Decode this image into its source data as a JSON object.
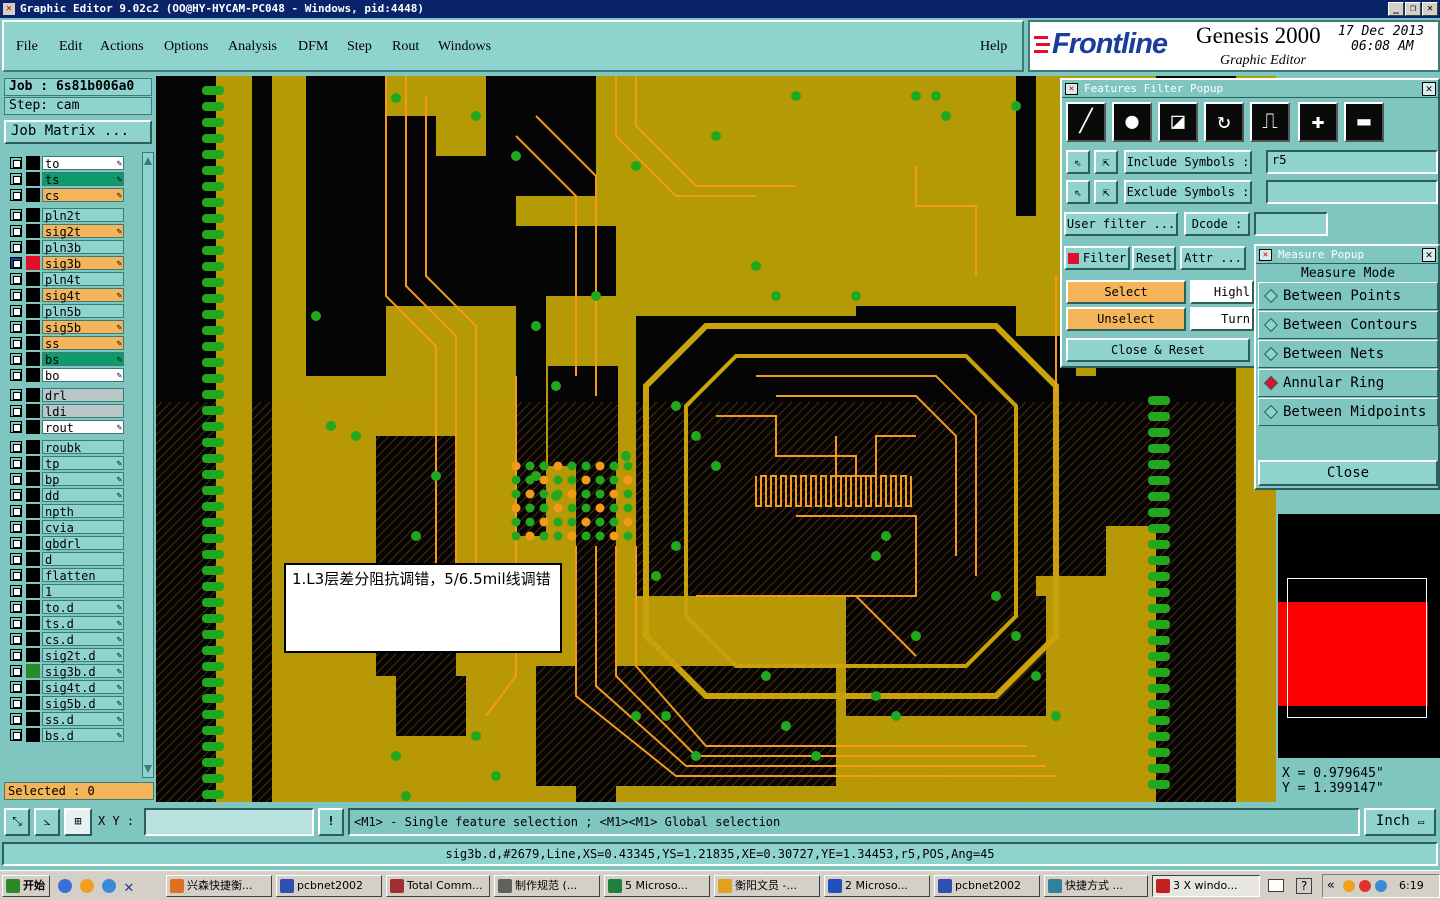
{
  "window": {
    "title": "Graphic Editor 9.02c2 (OO@HY-HYCAM-PC048 - Windows, pid:4448)",
    "controls": [
      "_",
      "❐",
      "✕"
    ]
  },
  "menu": [
    "File",
    "Edit",
    "Actions",
    "Options",
    "Analysis",
    "DFM",
    "Step",
    "Rout",
    "Windows"
  ],
  "menu_help": "Help",
  "brand": {
    "logo": "Frontline",
    "product": "Genesis 2000",
    "subtitle": "Graphic Editor",
    "date": "17 Dec 2013",
    "time": "06:08 AM"
  },
  "job": {
    "job_label": "Job : 6s81b006a0",
    "step_label": "Step: cam",
    "matrix_button": "Job Matrix ..."
  },
  "layers": [
    {
      "name": "to",
      "color": "#ffffff",
      "pen": true
    },
    {
      "name": "ts",
      "color": "#0f9a6a",
      "pen": true
    },
    {
      "name": "cs",
      "color": "#f4b55a",
      "pen": true
    },
    {
      "name": "pln2t",
      "color": "#8fd3cf",
      "pen": false
    },
    {
      "name": "sig2t",
      "color": "#f4b55a",
      "pen": true
    },
    {
      "name": "pln3b",
      "color": "#8fd3cf",
      "pen": false
    },
    {
      "name": "sig3b",
      "color": "#f4b55a",
      "pen": true
    },
    {
      "name": "pln4t",
      "color": "#8fd3cf",
      "pen": false
    },
    {
      "name": "sig4t",
      "color": "#f4b55a",
      "pen": true
    },
    {
      "name": "pln5b",
      "color": "#8fd3cf",
      "pen": false
    },
    {
      "name": "sig5b",
      "color": "#f4b55a",
      "pen": true
    },
    {
      "name": "ss",
      "color": "#f4b55a",
      "pen": true
    },
    {
      "name": "bs",
      "color": "#0f9a6a",
      "pen": true
    },
    {
      "name": "bo",
      "color": "#ffffff",
      "pen": true
    },
    {
      "name": "drl",
      "color": "#b8c8c8",
      "pen": false
    },
    {
      "name": "ldi",
      "color": "#b8c8c8",
      "pen": false
    },
    {
      "name": "rout",
      "color": "#ffffff",
      "pen": true
    },
    {
      "name": "roubk",
      "color": "#8fd3cf",
      "pen": false
    },
    {
      "name": "tp",
      "color": "#8fd3cf",
      "pen": true
    },
    {
      "name": "bp",
      "color": "#8fd3cf",
      "pen": true
    },
    {
      "name": "dd",
      "color": "#8fd3cf",
      "pen": true
    },
    {
      "name": "npth",
      "color": "#8fd3cf",
      "pen": false
    },
    {
      "name": "cvia",
      "color": "#8fd3cf",
      "pen": false
    },
    {
      "name": "gbdrl",
      "color": "#8fd3cf",
      "pen": false
    },
    {
      "name": "d",
      "color": "#8fd3cf",
      "pen": false
    },
    {
      "name": "flatten",
      "color": "#8fd3cf",
      "pen": false
    },
    {
      "name": "1",
      "color": "#8fd3cf",
      "pen": false
    },
    {
      "name": "to.d",
      "color": "#8fd3cf",
      "pen": true
    },
    {
      "name": "ts.d",
      "color": "#8fd3cf",
      "pen": true
    },
    {
      "name": "cs.d",
      "color": "#8fd3cf",
      "pen": true
    },
    {
      "name": "sig2t.d",
      "color": "#8fd3cf",
      "pen": true
    },
    {
      "name": "sig3b.d",
      "color": "#8fd3cf",
      "pen": true
    },
    {
      "name": "sig4t.d",
      "color": "#8fd3cf",
      "pen": true
    },
    {
      "name": "sig5b.d",
      "color": "#8fd3cf",
      "pen": true
    },
    {
      "name": "ss.d",
      "color": "#8fd3cf",
      "pen": true
    },
    {
      "name": "bs.d",
      "color": "#8fd3cf",
      "pen": true
    }
  ],
  "selected_label": "Selected : 0",
  "features_filter": {
    "title": "Features Filter Popup",
    "include_label": "Include Symbols :",
    "include_value": "r5",
    "exclude_label": "Exclude Symbols :",
    "exclude_value": "",
    "user_filter": "User filter ...",
    "dcode_label": "Dcode :",
    "filter_label": "Filter",
    "reset": "Reset",
    "attr": "Attr ...",
    "select": "Select",
    "unselect": "Unselect",
    "highlight": "Highl",
    "turn": "Turn",
    "close_reset": "Close & Reset",
    "tool_icons": [
      "line-icon",
      "pad-icon",
      "surface-icon",
      "arc-icon",
      "text-icon",
      "plus-icon",
      "minus-icon"
    ]
  },
  "measure": {
    "title": "Measure Popup",
    "mode_label": "Measure Mode",
    "options": [
      "Between Points",
      "Between Contours",
      "Between Nets",
      "Annular Ring",
      "Between Midpoints"
    ],
    "selected": "Annular Ring",
    "close": "Close"
  },
  "coords": {
    "x": "X = 0.979645\"",
    "y": "Y = 1.399147\""
  },
  "annotation": "1.L3层差分阻抗调错，5/6.5mil线调错",
  "bottom": {
    "xy_label": "X Y :",
    "xy_value": "",
    "hint": "<M1> - Single feature selection ; <M1><M1> Global selection",
    "units": "Inch"
  },
  "status_line": "sig3b.d,#2679,Line,XS=0.43345,YS=1.21835,XE=0.30727,YE=1.34453,r5,POS,Ang=45",
  "taskbar": {
    "start": "开始",
    "tasks": [
      "兴森快捷衡...",
      "pcbnet2002",
      "Total Comm...",
      "制作规范 (...",
      "5 Microso...",
      "衡阳文员 -...",
      "2 Microso...",
      "pcbnet2002",
      "快捷方式 ...",
      "3 X windo..."
    ],
    "clock": "6:19"
  },
  "colors": {
    "panel": "#7fc5c0",
    "board": "#b59a05",
    "trace": "#f39a1a",
    "pad": "#22a81e",
    "highlight": "#ff0000"
  }
}
